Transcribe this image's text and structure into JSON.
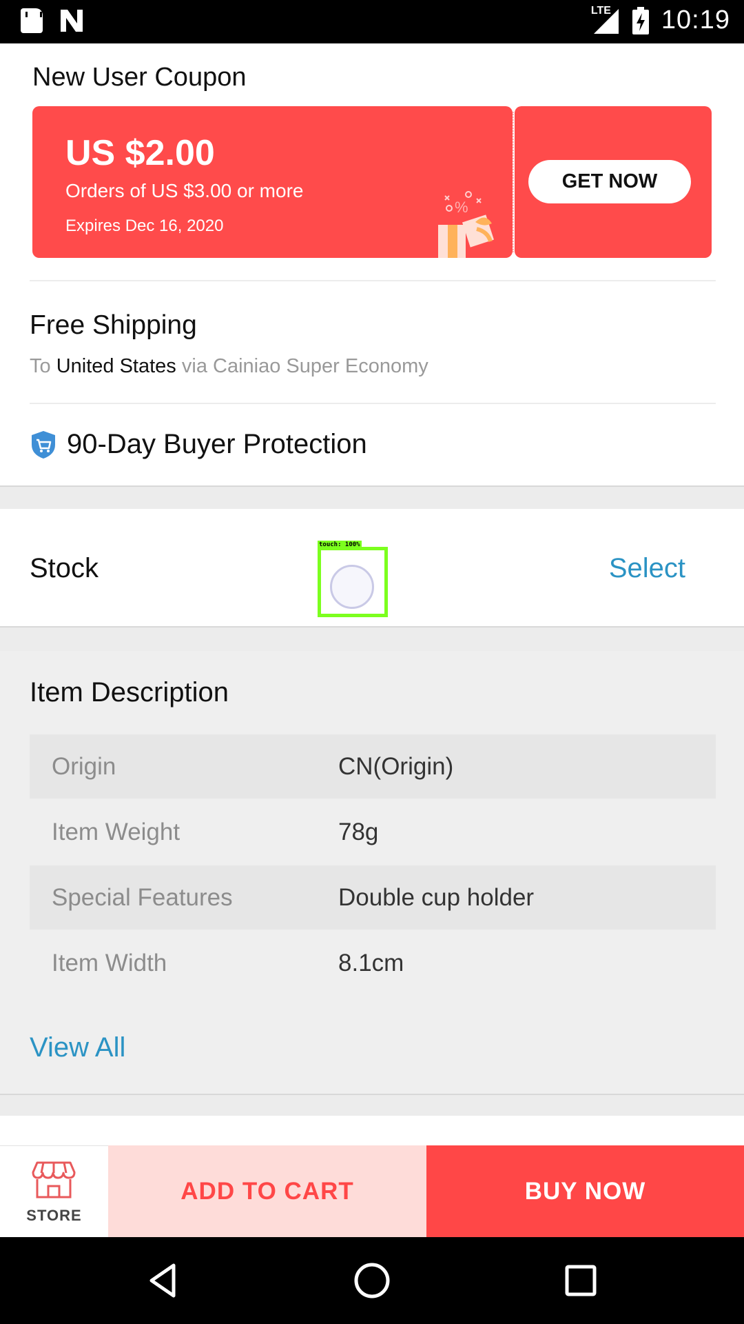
{
  "status_bar": {
    "icons": [
      "sd-card-icon",
      "n-notification-icon",
      "lte-signal-icon",
      "battery-charging-icon"
    ],
    "network": "LTE",
    "time": "10:19"
  },
  "coupon": {
    "title": "New User Coupon",
    "amount": "US $2.00",
    "condition": "Orders of US $3.00 or more",
    "expiry": "Expires Dec 16, 2020",
    "cta": "GET NOW",
    "color": "#ff4b4b"
  },
  "shipping": {
    "title": "Free Shipping",
    "to_label": "To",
    "destination": "United States",
    "via_label": "via Cainiao Super Economy"
  },
  "protection": {
    "icon": "shield-cart-icon",
    "label": "90-Day Buyer Protection"
  },
  "stock": {
    "label": "Stock",
    "action": "Select",
    "touch_overlay": "touch: 100%"
  },
  "description": {
    "title": "Item Description",
    "specs": [
      {
        "key": "Origin",
        "value": "CN(Origin)"
      },
      {
        "key": "Item Weight",
        "value": "78g"
      },
      {
        "key": "Special Features",
        "value": "Double cup holder"
      },
      {
        "key": "Item Width",
        "value": "8.1cm"
      }
    ],
    "view_all": "View All"
  },
  "actions": {
    "store_label": "STORE",
    "add_to_cart": "ADD TO CART",
    "buy_now": "BUY NOW",
    "accent": "#ff4747",
    "link_color": "#2b93c4"
  },
  "nav_bar": {
    "icons": [
      "back-icon",
      "home-icon",
      "recents-icon"
    ]
  }
}
